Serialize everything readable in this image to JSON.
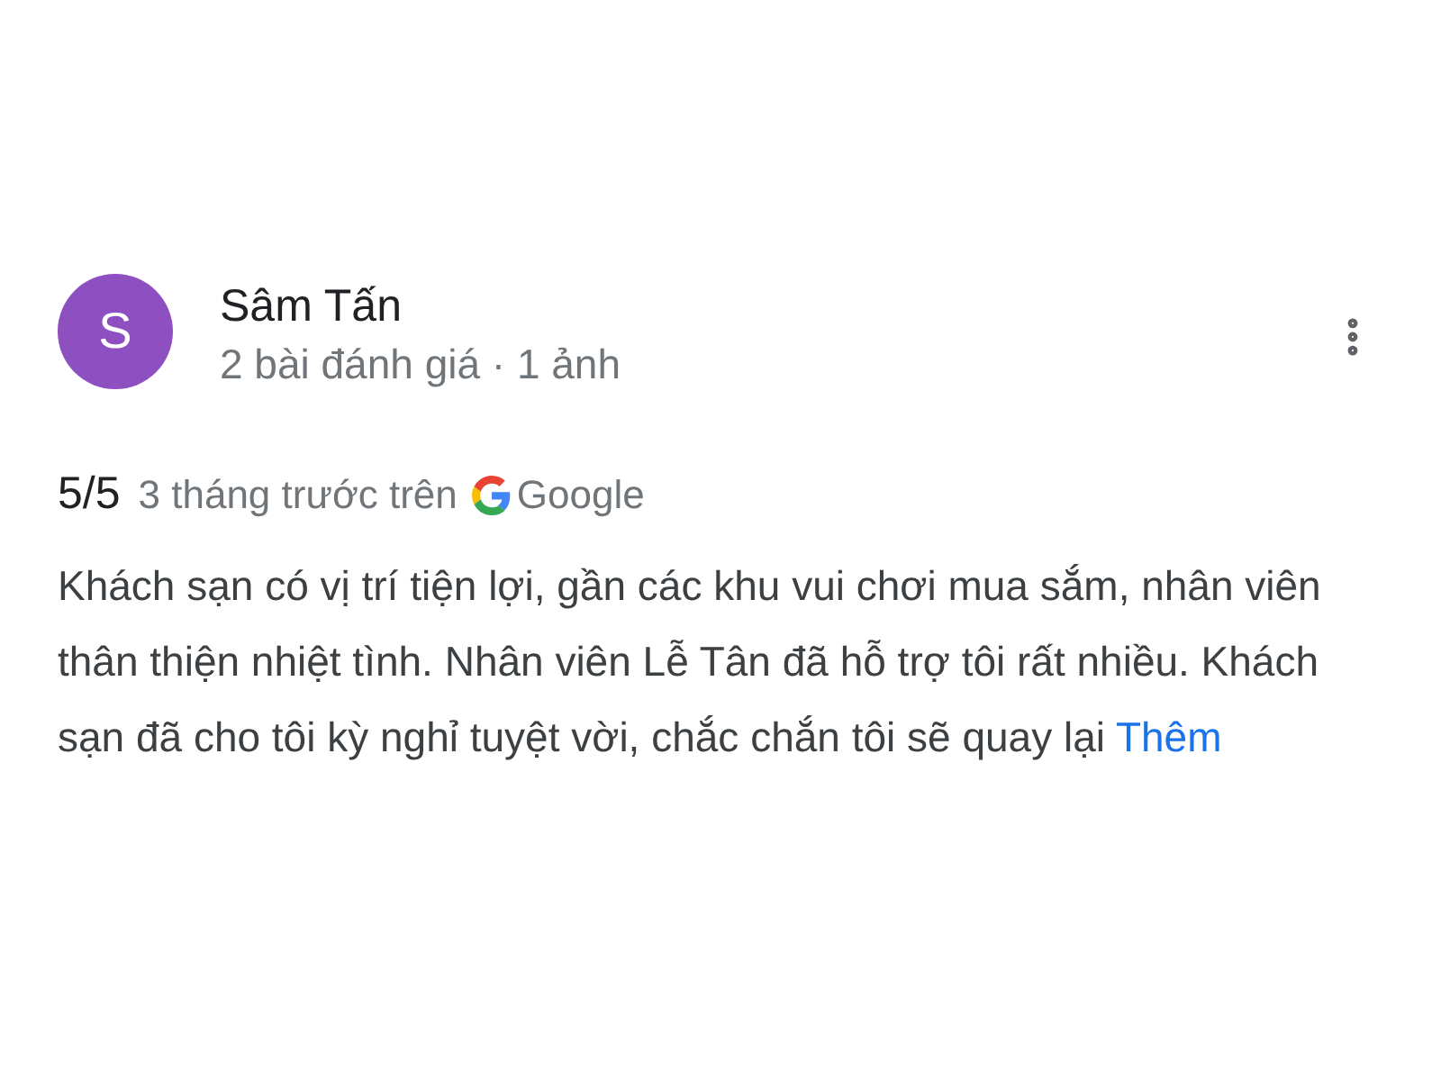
{
  "review": {
    "author": {
      "initial": "S",
      "name": "Sâm Tấn",
      "meta": "2 bài đánh giá · 1 ảnh"
    },
    "rating": "5/5",
    "time": "3 tháng trước trên",
    "source": "Google",
    "text": "Khách sạn có vị trí tiện lợi, gần các khu vui chơi mua sắm, nhân viên thân thiện nhiệt tình. Nhân viên Lễ Tân đã hỗ trợ tôi rất nhiều. Khách sạn đã cho tôi kỳ nghỉ tuyệt vời, chắc chắn tôi sẽ quay lại",
    "more_link": "Thêm"
  }
}
